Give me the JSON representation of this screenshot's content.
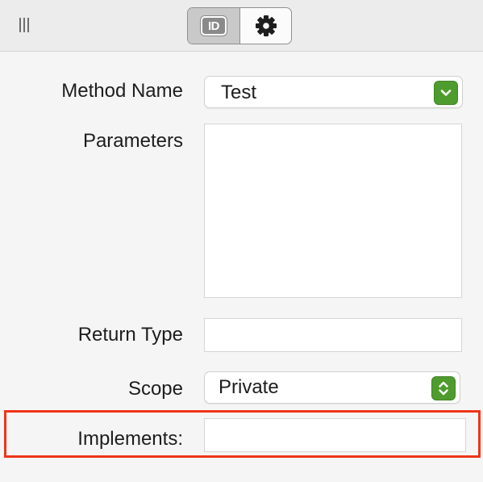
{
  "toolbar": {
    "tabs": [
      {
        "id": "identity",
        "label": "ID",
        "icon": "id-card-icon",
        "selected": true
      },
      {
        "id": "settings",
        "label": "",
        "icon": "gear-icon",
        "selected": false
      }
    ]
  },
  "form": {
    "method_name": {
      "label": "Method Name",
      "value": "Test"
    },
    "parameters": {
      "label": "Parameters",
      "value": ""
    },
    "return_type": {
      "label": "Return Type",
      "value": ""
    },
    "scope": {
      "label": "Scope",
      "value": "Private"
    },
    "implements": {
      "label": "Implements:",
      "value": ""
    }
  },
  "colors": {
    "accent_green": "#4f9c2e",
    "highlight_red": "#ee3518"
  }
}
